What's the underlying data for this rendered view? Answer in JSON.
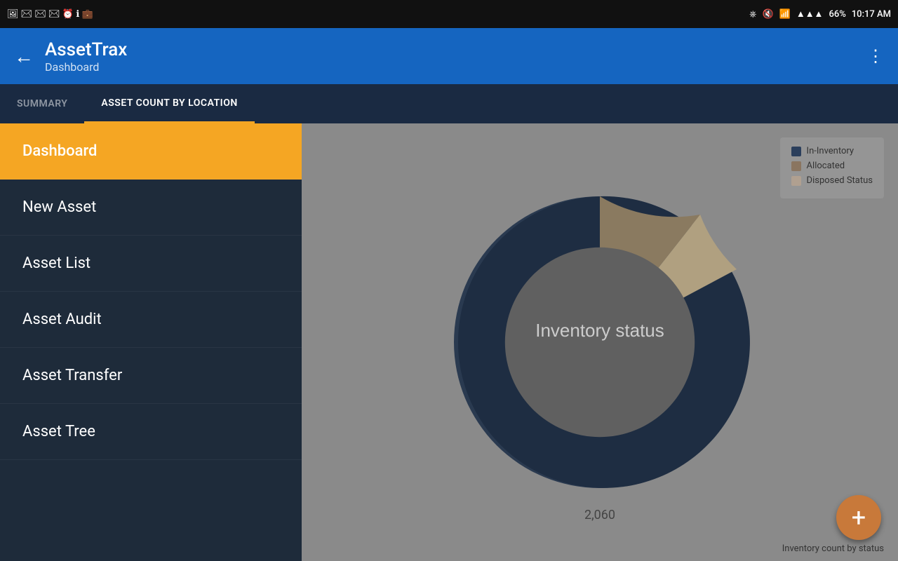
{
  "status_bar": {
    "time": "10:17 AM",
    "battery": "66%",
    "signal_icons": "▲ ▲ ▲"
  },
  "app_bar": {
    "back_icon": "←",
    "title": "AssetTrax",
    "subtitle": "Dashboard",
    "menu_icon": "⋮"
  },
  "tabs": [
    {
      "id": "summary",
      "label": "SUMMARY",
      "active": false
    },
    {
      "id": "asset-count-by-location",
      "label": "ASSET COUNT BY LOCATION",
      "active": true
    }
  ],
  "sidebar": {
    "items": [
      {
        "id": "dashboard",
        "label": "Dashboard",
        "active": true
      },
      {
        "id": "new-asset",
        "label": "New Asset",
        "active": false
      },
      {
        "id": "asset-list",
        "label": "Asset List",
        "active": false
      },
      {
        "id": "asset-audit",
        "label": "Asset Audit",
        "active": false
      },
      {
        "id": "asset-transfer",
        "label": "Asset Transfer",
        "active": false
      },
      {
        "id": "asset-tree",
        "label": "Asset Tree",
        "active": false
      }
    ]
  },
  "chart": {
    "title": "ASSET COUNT BY LOCATION",
    "center_label": "Inventory status",
    "value_label": "2,060",
    "legend": [
      {
        "id": "in-inventory",
        "label": "In-Inventory",
        "color": "#2b3f5c"
      },
      {
        "id": "allocated",
        "label": "Allocated",
        "color": "#8a7560"
      },
      {
        "id": "disposed",
        "label": "Disposed Status",
        "color": "#b0a090"
      }
    ],
    "bottom_label": "Inventory count by status",
    "segments": [
      {
        "label": "In-Inventory",
        "value": 85,
        "color": "#1e2d42"
      },
      {
        "label": "Allocated",
        "value": 10,
        "color": "#7a6a50"
      },
      {
        "label": "Disposed",
        "value": 5,
        "color": "#b0a080"
      }
    ]
  },
  "fab": {
    "icon": "+",
    "label": "add"
  }
}
